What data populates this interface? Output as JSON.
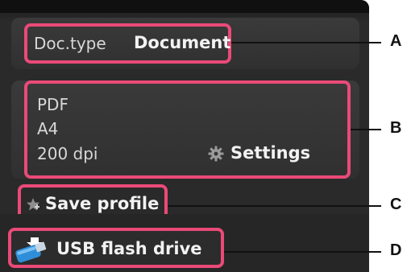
{
  "doc_type": {
    "label": "Doc.type",
    "value": "Document"
  },
  "scan_settings": {
    "format": "PDF",
    "paper_size": "A4",
    "resolution": "200 dpi",
    "settings_label": "Settings"
  },
  "save_profile_label": "Save profile",
  "destination_label": "USB flash drive",
  "callouts": [
    "A",
    "B",
    "C",
    "D"
  ],
  "colors": {
    "highlight": "#ea4a78",
    "screen": "#2a2a2a",
    "usb_icon": "#2f8ed8"
  }
}
